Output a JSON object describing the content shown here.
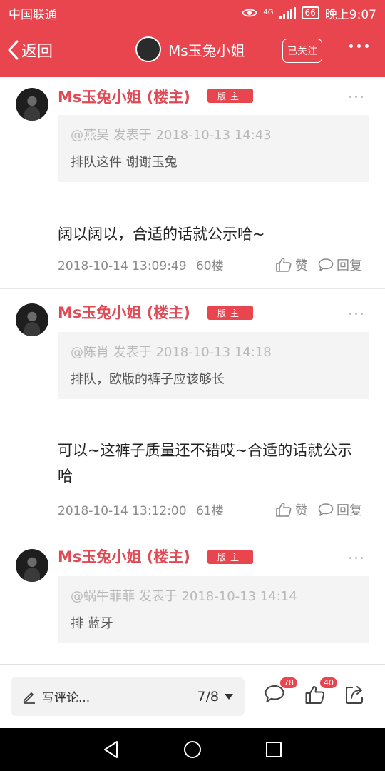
{
  "status": {
    "carrier": "中国联通",
    "network": "4G",
    "battery": "66",
    "time": "晚上9:07"
  },
  "header": {
    "back_label": "返回",
    "title": "Ms玉兔小姐",
    "follow_label": "已关注"
  },
  "posts": [
    {
      "author": "Ms玉兔小姐 (楼主)",
      "badge": "版主",
      "quote_author": "@燕昊",
      "quote_meta": "发表于 2018-10-13 14:43",
      "quote_text": "排队这件 谢谢玉兔",
      "body": "阔以阔以，合适的话就公示哈~",
      "timestamp": "2018-10-14 13:09:49",
      "floor": "60楼",
      "like_label": "赞",
      "reply_label": "回复"
    },
    {
      "author": "Ms玉兔小姐 (楼主)",
      "badge": "版主",
      "quote_author": "@陈肖",
      "quote_meta": "发表于 2018-10-13 14:18",
      "quote_text": "排队，欧版的裤子应该够长",
      "body": "可以~这裤子质量还不错哎~合适的话就公示哈",
      "timestamp": "2018-10-14 13:12:00",
      "floor": "61楼",
      "like_label": "赞",
      "reply_label": "回复"
    },
    {
      "author": "Ms玉兔小姐 (楼主)",
      "badge": "版主",
      "quote_author": "@蜗牛菲菲",
      "quote_meta": "发表于 2018-10-13 14:14",
      "quote_text": "排 蓝牙"
    }
  ],
  "bottom": {
    "composer_placeholder": "写评论...",
    "page_indicator": "7/8",
    "comment_count": "78",
    "like_count": "40"
  },
  "colors": {
    "brand": "#e8454f",
    "author": "#e04a55"
  }
}
